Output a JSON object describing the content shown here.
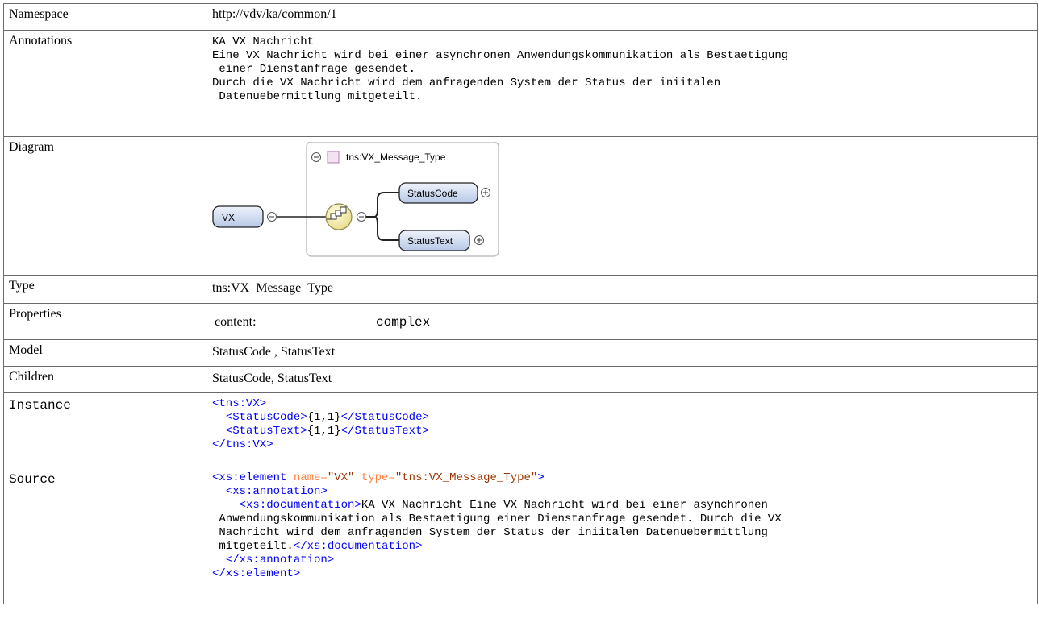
{
  "rows": {
    "namespace": {
      "label": "Namespace",
      "value": "http://vdv/ka/common/1"
    },
    "annotations": {
      "label": "Annotations",
      "lines": [
        "KA VX Nachricht",
        "Eine VX Nachricht wird bei einer asynchronen Anwendungskommunikation als Bestaetigung",
        " einer Dienstanfrage gesendet.",
        "Durch die VX Nachricht wird dem anfragenden System der Status der iniitalen",
        " Datenuebermittlung mitgeteilt."
      ]
    },
    "diagram": {
      "label": "Diagram",
      "group_title": "tns:VX_Message_Type",
      "element": "VX",
      "children": [
        "StatusCode",
        "StatusText"
      ]
    },
    "type": {
      "label": "Type",
      "value": "tns:VX_Message_Type"
    },
    "properties": {
      "label": "Properties",
      "key": "content:",
      "value": "complex"
    },
    "model": {
      "label": "Model",
      "value": "StatusCode , StatusText"
    },
    "children": {
      "label": "Children",
      "value": "StatusCode, StatusText"
    },
    "instance": {
      "label": "Instance",
      "open_tag": "<tns:VX>",
      "close_tag": "</tns:VX>",
      "items": [
        {
          "open": "<StatusCode>",
          "text": "{1,1}",
          "close": "</StatusCode>"
        },
        {
          "open": "<StatusText>",
          "text": "{1,1}",
          "close": "</StatusText>"
        }
      ]
    },
    "source": {
      "label": "Source",
      "el_open": "<xs:element",
      "name_attr": " name=",
      "name_val": "\"VX\"",
      "type_attr": " type=",
      "type_val": "\"tns:VX_Message_Type\"",
      "el_open_end": ">",
      "ann_open": "<xs:annotation>",
      "doc_open": "<xs:documentation>",
      "doc_lines": [
        "KA VX Nachricht Eine VX Nachricht wird bei einer asynchronen",
        " Anwendungskommunikation als Bestaetigung einer Dienstanfrage gesendet. Durch die VX",
        " Nachricht wird dem anfragenden System der Status der iniitalen Datenuebermittlung",
        " mitgeteilt."
      ],
      "doc_close": "</xs:documentation>",
      "ann_close": "</xs:annotation>",
      "el_close": "</xs:element>"
    }
  }
}
